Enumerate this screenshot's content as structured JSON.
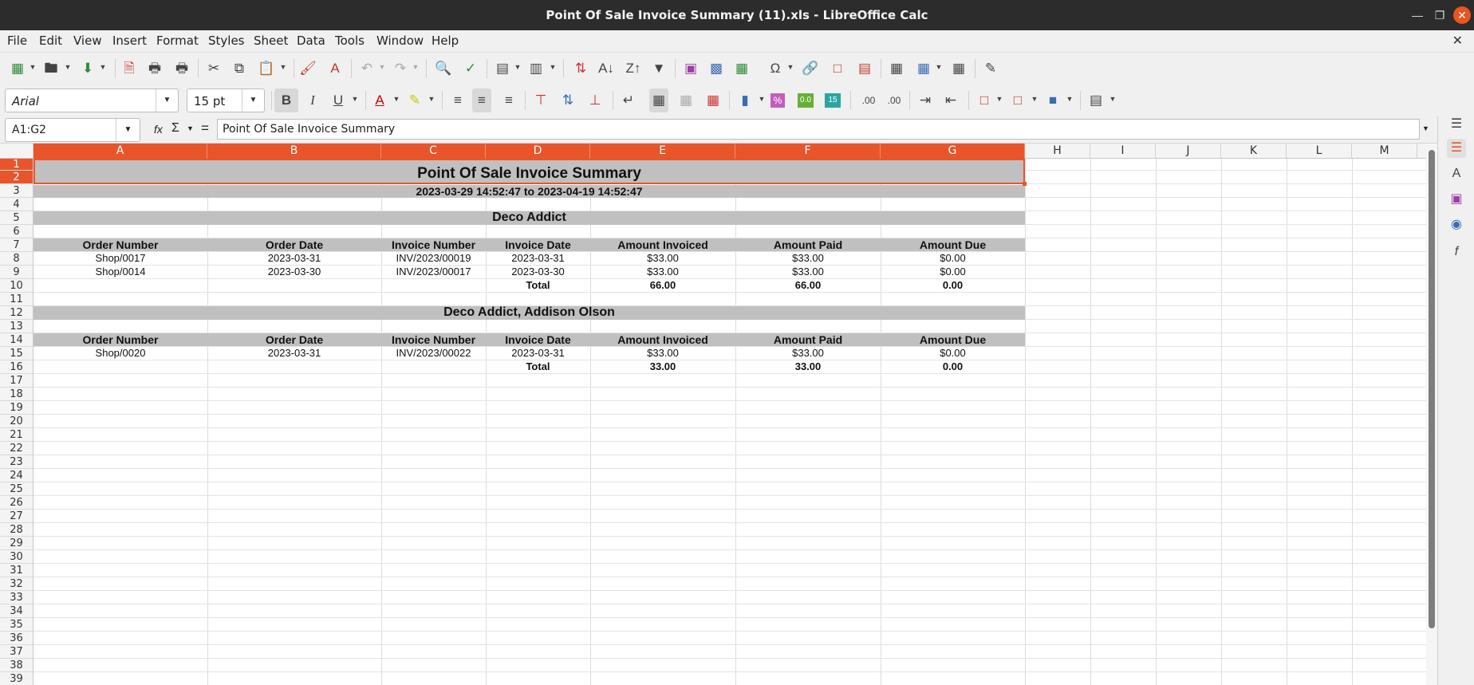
{
  "window": {
    "title": "Point Of Sale Invoice Summary (11).xls - LibreOffice Calc"
  },
  "menu": [
    "File",
    "Edit",
    "View",
    "Insert",
    "Format",
    "Styles",
    "Sheet",
    "Data",
    "Tools",
    "Window",
    "Help"
  ],
  "toolbar": {
    "font_name": "Arial",
    "font_size": "15 pt",
    "percent_icon": "%",
    "zero_icon": "0.0",
    "add_decimal": ".00",
    "del_decimal": ".00"
  },
  "formula_bar": {
    "name_box": "A1:G2",
    "content": "Point Of Sale Invoice Summary",
    "function_symbol": "fx",
    "sum_symbol": "Σ",
    "equals_symbol": "="
  },
  "colors": {
    "accent": "#e8552b",
    "band": "#c0c0c0",
    "titlebar": "#2c2c2c"
  },
  "columns": [
    "A",
    "B",
    "C",
    "D",
    "E",
    "F",
    "G",
    "H",
    "I",
    "J",
    "K",
    "L",
    "M"
  ],
  "rows": [
    "1",
    "2",
    "3",
    "4",
    "5",
    "6",
    "7",
    "8",
    "9",
    "10",
    "11",
    "12",
    "13",
    "14",
    "15",
    "16",
    "17",
    "18",
    "19",
    "20",
    "21",
    "22",
    "23",
    "24",
    "25",
    "26",
    "27",
    "28",
    "29",
    "30",
    "31",
    "32",
    "33",
    "34",
    "35",
    "36",
    "37",
    "38",
    "39"
  ],
  "report": {
    "title": "Point Of Sale Invoice Summary",
    "date_range": "2023-03-29 14:52:47 to 2023-04-19 14:52:47",
    "headers": [
      "Order Number",
      "Order Date",
      "Invoice Number",
      "Invoice Date",
      "Amount Invoiced",
      "Amount Paid",
      "Amount Due"
    ],
    "sections": [
      {
        "customer": "Deco Addict",
        "rows": [
          [
            "Shop/0017",
            "2023-03-31",
            "INV/2023/00019",
            "2023-03-31",
            "$33.00",
            "$33.00",
            "$0.00"
          ],
          [
            "Shop/0014",
            "2023-03-30",
            "INV/2023/00017",
            "2023-03-30",
            "$33.00",
            "$33.00",
            "$0.00"
          ]
        ],
        "total": {
          "label": "Total",
          "invoiced": "66.00",
          "paid": "66.00",
          "due": "0.00"
        }
      },
      {
        "customer": "Deco Addict, Addison Olson",
        "rows": [
          [
            "Shop/0020",
            "2023-03-31",
            "INV/2023/00022",
            "2023-03-31",
            "$33.00",
            "$33.00",
            "$0.00"
          ]
        ],
        "total": {
          "label": "Total",
          "invoiced": "33.00",
          "paid": "33.00",
          "due": "0.00"
        }
      }
    ]
  }
}
